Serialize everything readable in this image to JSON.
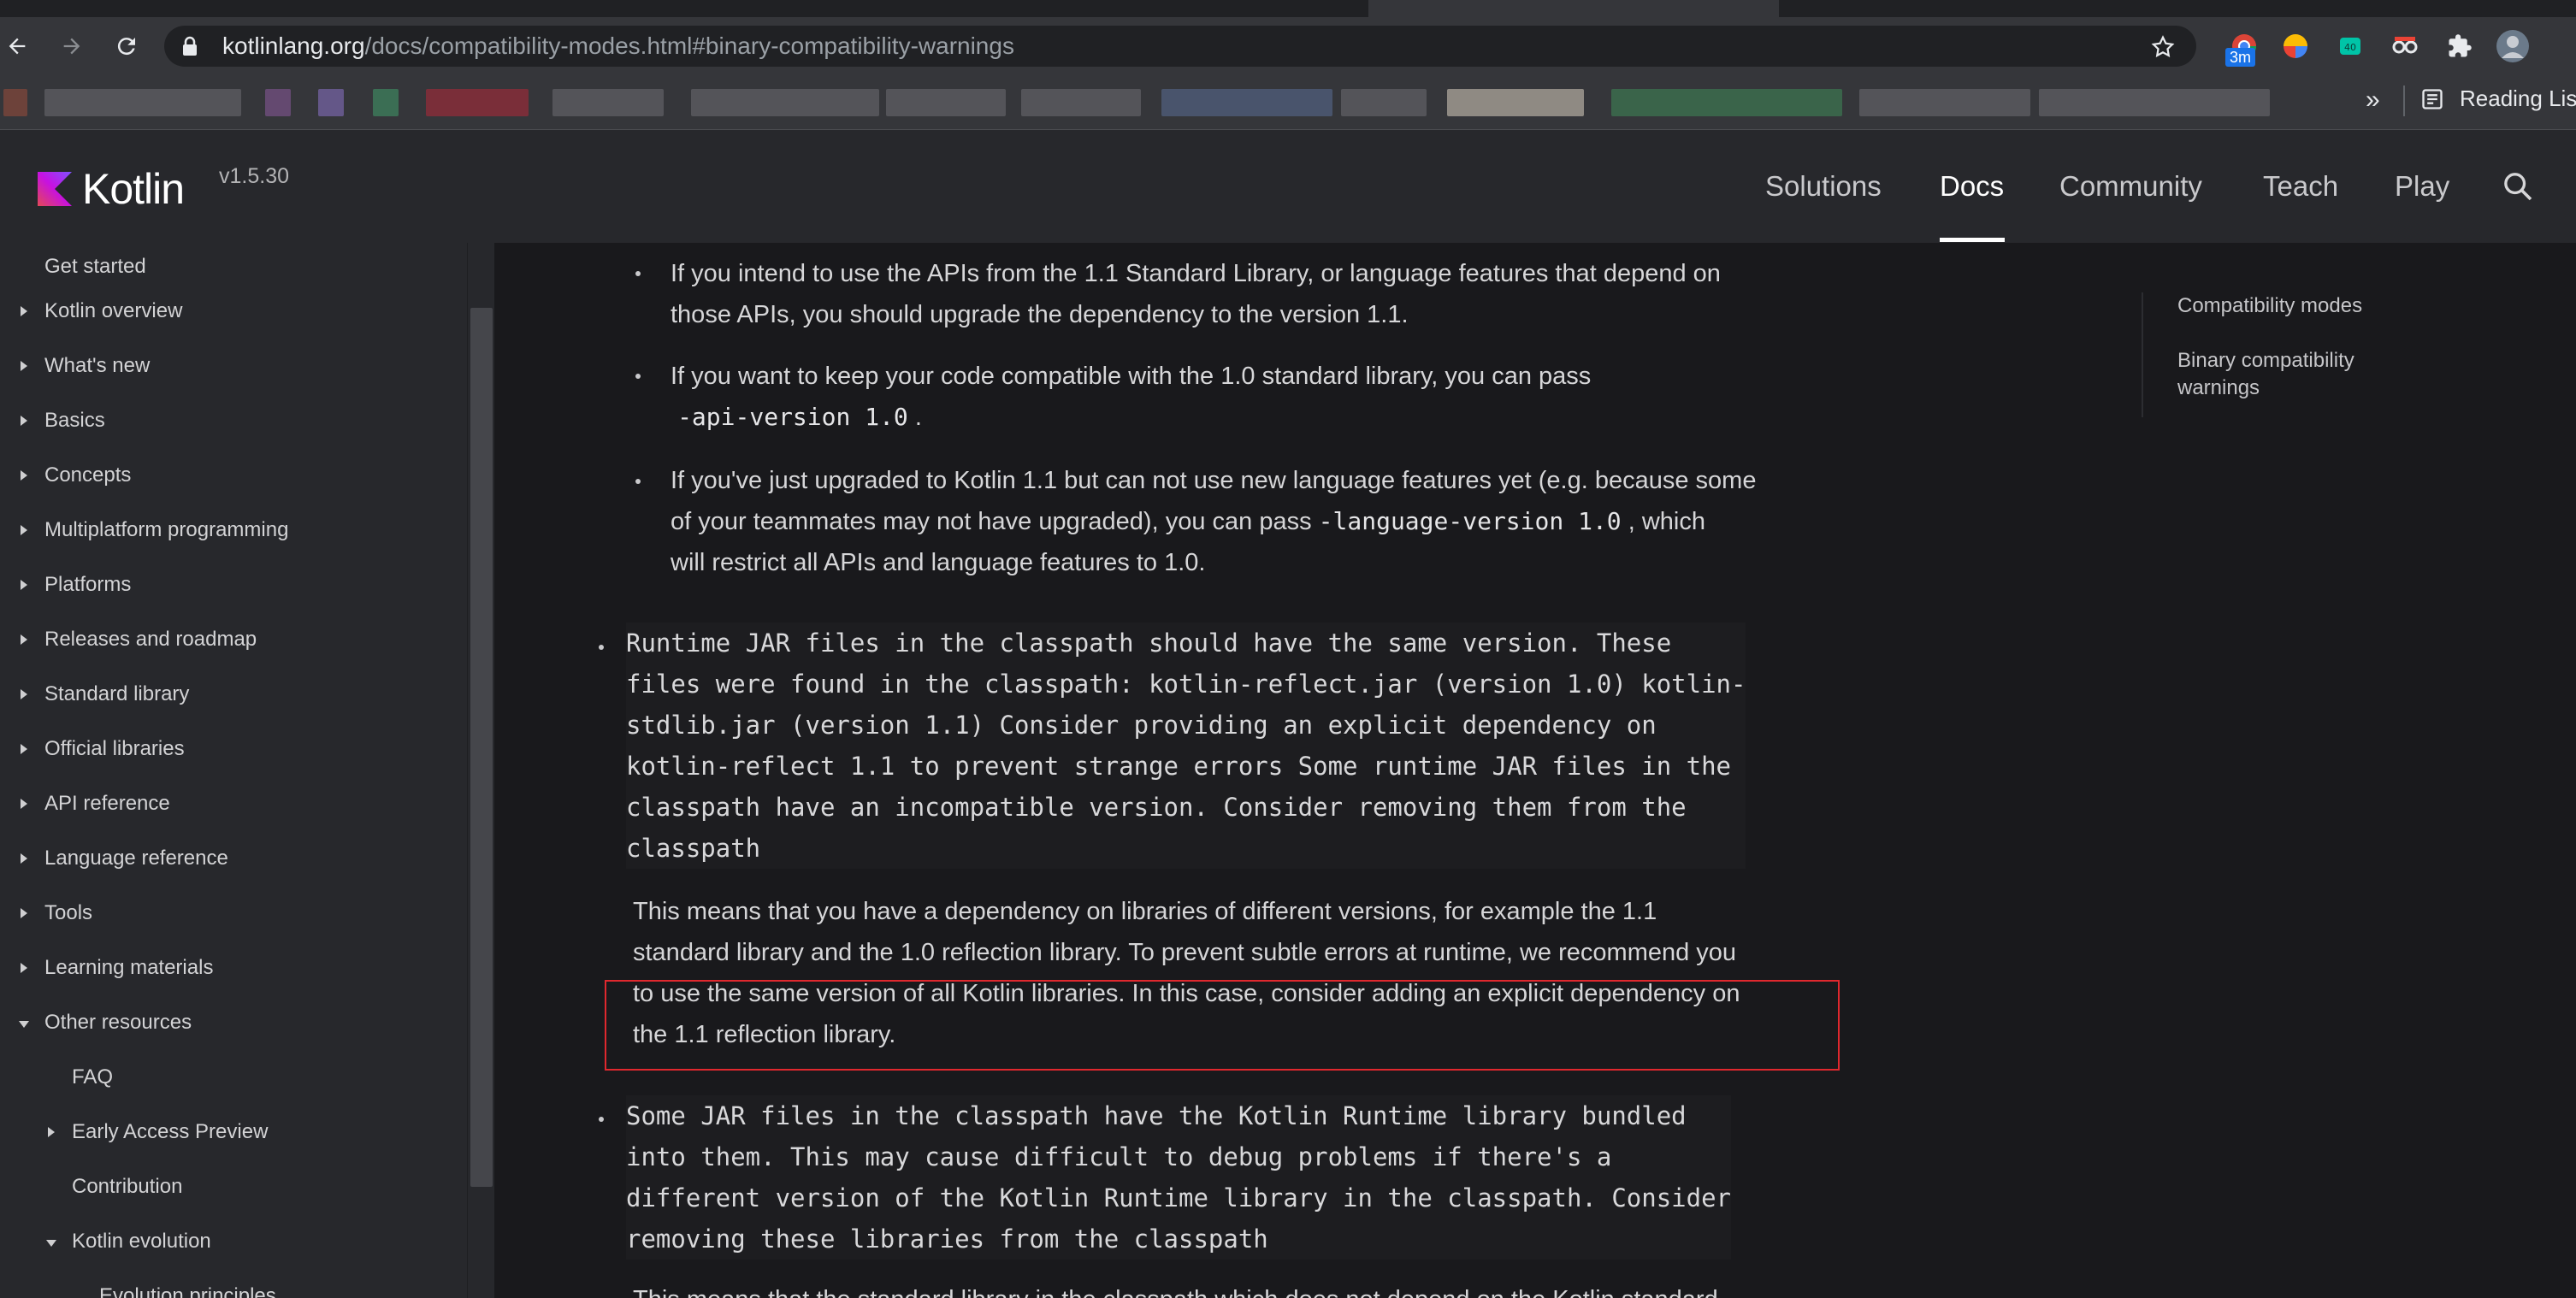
{
  "browser": {
    "url_host": "kotlinlang.org",
    "url_path": "/docs/compatibility-modes.html#binary-compatibility-warnings",
    "extension_badge": "3m",
    "bookmarks_more": "»",
    "reading_list": "Reading Lis"
  },
  "header": {
    "logo_text": "Kotlin",
    "version": "v1.5.30",
    "nav": [
      "Solutions",
      "Docs",
      "Community",
      "Teach",
      "Play"
    ],
    "active_nav": "Docs"
  },
  "sidebar": {
    "items": [
      {
        "label": "Get started",
        "expanded": null,
        "level": 0
      },
      {
        "label": "Kotlin overview",
        "expanded": false,
        "level": 0
      },
      {
        "label": "What's new",
        "expanded": false,
        "level": 0
      },
      {
        "label": "Basics",
        "expanded": false,
        "level": 0
      },
      {
        "label": "Concepts",
        "expanded": false,
        "level": 0
      },
      {
        "label": "Multiplatform programming",
        "expanded": false,
        "level": 0
      },
      {
        "label": "Platforms",
        "expanded": false,
        "level": 0
      },
      {
        "label": "Releases and roadmap",
        "expanded": false,
        "level": 0
      },
      {
        "label": "Standard library",
        "expanded": false,
        "level": 0
      },
      {
        "label": "Official libraries",
        "expanded": false,
        "level": 0
      },
      {
        "label": "API reference",
        "expanded": false,
        "level": 0
      },
      {
        "label": "Language reference",
        "expanded": false,
        "level": 0
      },
      {
        "label": "Tools",
        "expanded": false,
        "level": 0
      },
      {
        "label": "Learning materials",
        "expanded": false,
        "level": 0
      },
      {
        "label": "Other resources",
        "expanded": true,
        "level": 0
      },
      {
        "label": "FAQ",
        "expanded": null,
        "level": 1
      },
      {
        "label": "Early Access Preview",
        "expanded": false,
        "level": 1
      },
      {
        "label": "Contribution",
        "expanded": null,
        "level": 1
      },
      {
        "label": "Kotlin evolution",
        "expanded": true,
        "level": 1
      },
      {
        "label": "Evolution principles",
        "expanded": null,
        "level": 2
      }
    ]
  },
  "article": {
    "sub_bullets": [
      {
        "lines": [
          "If you intend to use the APIs from the 1.1 Standard Library, or language features that depend on",
          "those APIs, you should upgrade the dependency to the version 1.1."
        ]
      },
      {
        "lines": [
          "If you want to keep your code compatible with the 1.0 standard library, you can pass"
        ],
        "code": "-api-version 1.0",
        "after_code": "."
      },
      {
        "line1": "If you've just upgraded to Kotlin 1.1 but can not use new language features yet (e.g. because some",
        "line2_before": "of your teammates may not have upgraded), you can pass",
        "line2_code": "-language-version 1.0",
        "line2_after": ", which",
        "line3": "will restrict all APIs and language features to 1.0."
      }
    ],
    "warning_1": "Runtime JAR files in the classpath should have the same version. These\nfiles were found in the classpath: kotlin-reflect.jar (version 1.0) kotlin-\nstdlib.jar (version 1.1) Consider providing an explicit dependency on\nkotlin-reflect 1.1 to prevent strange errors Some runtime JAR files in the\nclasspath have an incompatible version. Consider removing them from the\nclasspath",
    "explanation_1": [
      "This means that you have a dependency on libraries of different versions, for example the 1.1",
      "standard library and the 1.0 reflection library. To prevent subtle errors at runtime, we recommend you",
      "to use the same version of all Kotlin libraries. In this case, consider adding an explicit dependency on",
      "the 1.1 reflection library."
    ],
    "warning_2": "Some JAR files in the classpath have the Kotlin Runtime library bundled\ninto them. This may cause difficult to debug problems if there's a\ndifferent version of the Kotlin Runtime library in the classpath. Consider\nremoving these libraries from the classpath",
    "explanation_2_partial": "This means that the standard library in the classpath which does not depend on the Kotlin standard"
  },
  "toc": {
    "items": [
      "Compatibility modes",
      "Binary compatibility warnings"
    ]
  },
  "colors": {
    "highlight_border": "#e0282e",
    "header_bg": "#27282c",
    "page_bg": "#19191c"
  }
}
